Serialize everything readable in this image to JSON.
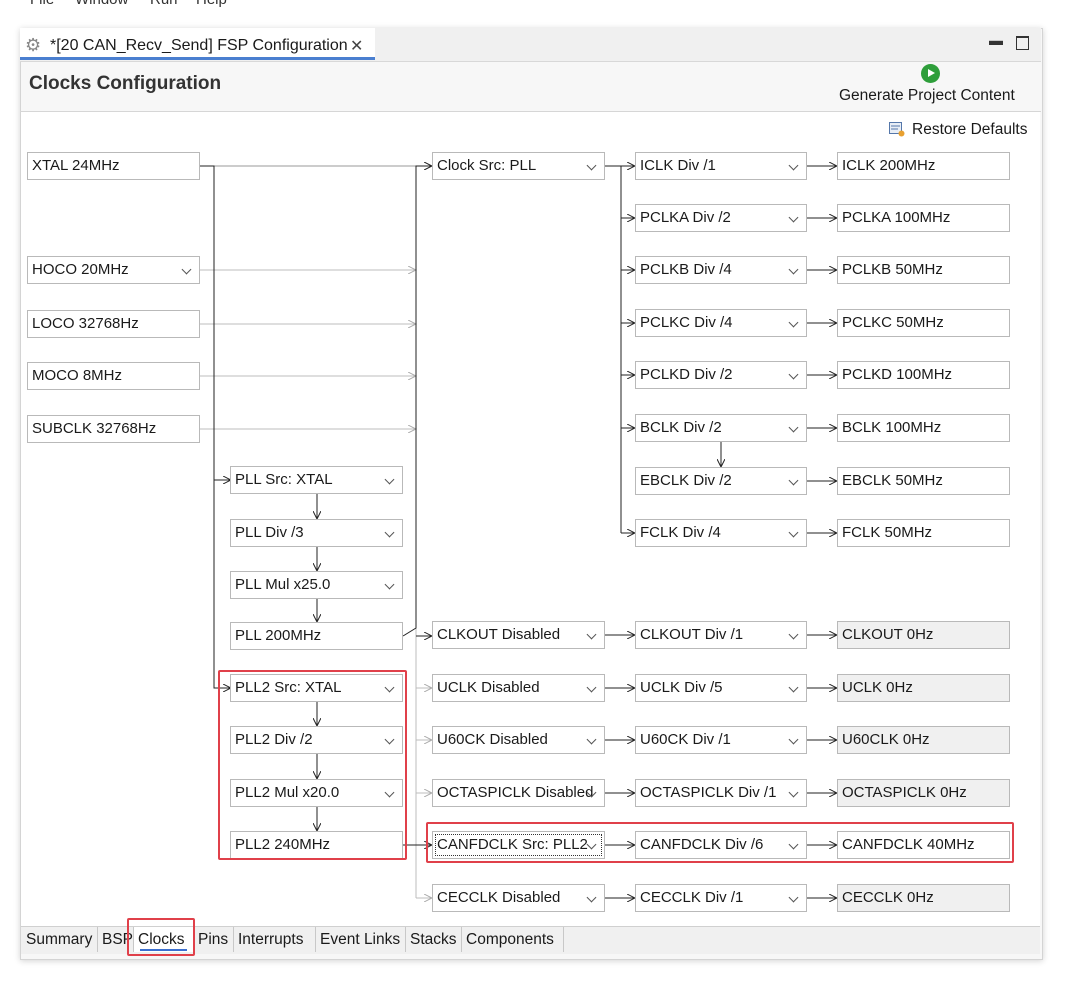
{
  "menu": [
    "File",
    "Window",
    "Run",
    "Help"
  ],
  "tab": {
    "title": "*[20 CAN_Recv_Send] FSP Configuration",
    "icon": "gear-icon"
  },
  "page_title": "Clocks Configuration",
  "generate_label": "Generate Project Content",
  "restore_label": "Restore Defaults",
  "sources": {
    "xtal": "XTAL 24MHz",
    "hoco": "HOCO 20MHz",
    "loco": "LOCO 32768Hz",
    "moco": "MOCO 8MHz",
    "subclk": "SUBCLK 32768Hz"
  },
  "pll": {
    "src": "PLL Src: XTAL",
    "div": "PLL Div /3",
    "mul": "PLL Mul x25.0",
    "out": "PLL 200MHz"
  },
  "pll2": {
    "src": "PLL2 Src: XTAL",
    "div": "PLL2 Div /2",
    "mul": "PLL2 Mul x20.0",
    "out": "PLL2 240MHz"
  },
  "clock_src": "Clock Src: PLL",
  "system_clocks": [
    {
      "div": "ICLK Div /1",
      "out": "ICLK 200MHz"
    },
    {
      "div": "PCLKA Div /2",
      "out": "PCLKA 100MHz"
    },
    {
      "div": "PCLKB Div /4",
      "out": "PCLKB 50MHz"
    },
    {
      "div": "PCLKC Div /4",
      "out": "PCLKC 50MHz"
    },
    {
      "div": "PCLKD Div /2",
      "out": "PCLKD 100MHz"
    },
    {
      "div": "BCLK Div /2",
      "out": "BCLK 100MHz"
    },
    {
      "div": "EBCLK Div /2",
      "out": "EBCLK 50MHz"
    },
    {
      "div": "FCLK Div /4",
      "out": "FCLK 50MHz"
    }
  ],
  "peripheral_clocks": [
    {
      "src": "CLKOUT Disabled",
      "div": "CLKOUT Div /1",
      "out": "CLKOUT 0Hz"
    },
    {
      "src": "UCLK Disabled",
      "div": "UCLK Div /5",
      "out": "UCLK 0Hz"
    },
    {
      "src": "U60CK Disabled",
      "div": "U60CK Div /1",
      "out": "U60CLK 0Hz"
    },
    {
      "src": "OCTASPICLK Disabled",
      "div": "OCTASPICLK Div /1",
      "out": "OCTASPICLK 0Hz"
    },
    {
      "src": "CANFDCLK Src: PLL2",
      "div": "CANFDCLK Div /6",
      "out": "CANFDCLK 40MHz"
    },
    {
      "src": "CECCLK Disabled",
      "div": "CECCLK Div /1",
      "out": "CECCLK 0Hz"
    }
  ],
  "bottom_tabs": [
    "Summary",
    "BSP",
    "Clocks",
    "Pins",
    "Interrupts",
    "Event Links",
    "Stacks",
    "Components"
  ],
  "active_bottom_tab": "Clocks",
  "colors": {
    "highlight": "#e0404a",
    "accent": "#4a7fd0",
    "generate": "#2e9e3a"
  }
}
